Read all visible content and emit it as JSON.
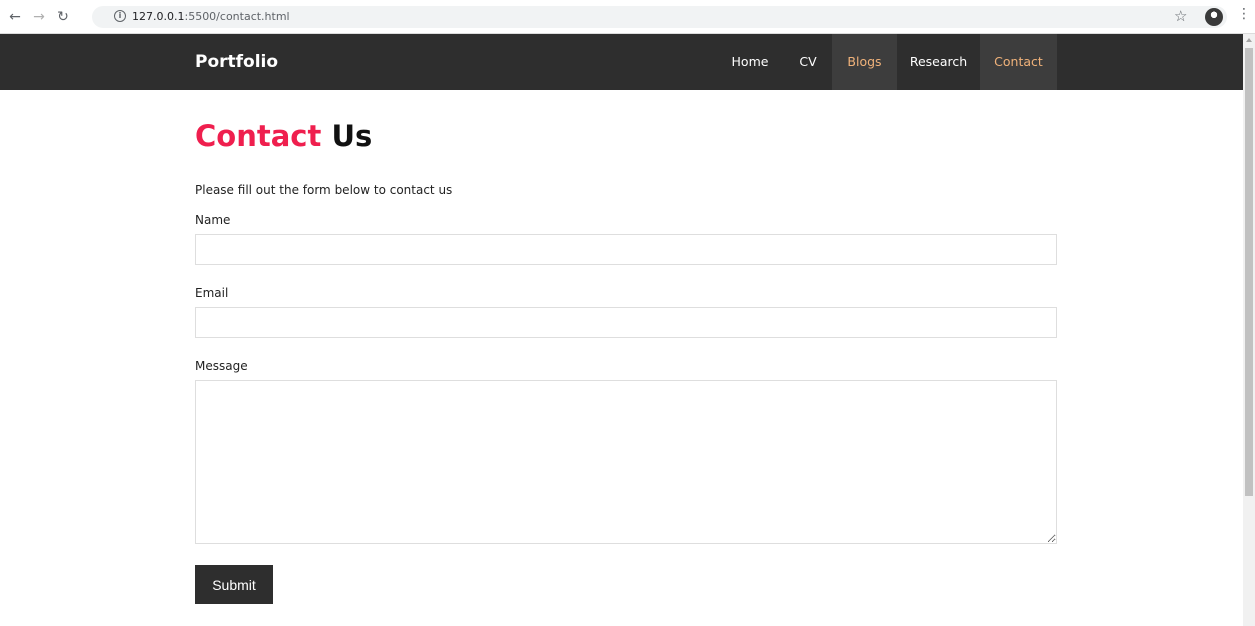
{
  "browser": {
    "url_host": "127.0.0.1",
    "url_path": ":5500/contact.html",
    "icons": [
      "back-arrow-icon",
      "forward-arrow-icon",
      "reload-icon",
      "info-icon",
      "star-icon",
      "profile-avatar-icon",
      "menu-dots-icon"
    ]
  },
  "nav": {
    "brand": "Portfolio",
    "links": [
      {
        "label": "Home"
      },
      {
        "label": "CV"
      },
      {
        "label": "Blogs"
      },
      {
        "label": "Research"
      },
      {
        "label": "Contact"
      }
    ],
    "background_color": "#2e2e2e",
    "active_link_color": "#f0b27a"
  },
  "page": {
    "heading_accent": "Contact",
    "heading_rest": " Us",
    "accent_color": "#ef1f4e",
    "intro": "Please fill out the form below to contact us"
  },
  "form": {
    "name_label": "Name",
    "name_value": "",
    "email_label": "Email",
    "email_value": "",
    "message_label": "Message",
    "message_value": "",
    "submit_label": "Submit"
  }
}
